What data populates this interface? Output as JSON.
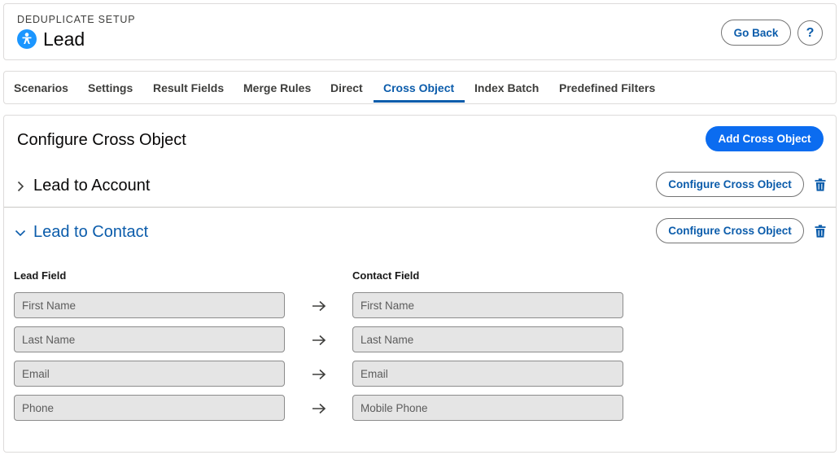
{
  "header": {
    "eyebrow": "DEDUPLICATE SETUP",
    "title": "Lead",
    "go_back_label": "Go Back",
    "help_label": "?"
  },
  "tabs": [
    {
      "label": "Scenarios",
      "active": false
    },
    {
      "label": "Settings",
      "active": false
    },
    {
      "label": "Result Fields",
      "active": false
    },
    {
      "label": "Merge Rules",
      "active": false
    },
    {
      "label": "Direct",
      "active": false
    },
    {
      "label": "Cross Object",
      "active": true
    },
    {
      "label": "Index Batch",
      "active": false
    },
    {
      "label": "Predefined Filters",
      "active": false
    }
  ],
  "main": {
    "title": "Configure Cross Object",
    "add_button_label": "Add Cross Object",
    "sections": [
      {
        "title": "Lead to Account",
        "expanded": false,
        "configure_label": "Configure Cross Object"
      },
      {
        "title": "Lead to Contact",
        "expanded": true,
        "configure_label": "Configure Cross Object"
      }
    ],
    "mapping": {
      "lead_header": "Lead Field",
      "contact_header": "Contact Field",
      "rows": [
        {
          "lead": "First Name",
          "contact": "First Name"
        },
        {
          "lead": "Last Name",
          "contact": "Last Name"
        },
        {
          "lead": "Email",
          "contact": "Email"
        },
        {
          "lead": "Phone",
          "contact": "Mobile Phone"
        }
      ]
    }
  },
  "colors": {
    "brand_blue": "#0b5cab",
    "primary_button": "#0b6cf0",
    "icon_blue": "#1b96ff",
    "field_background": "#e5e5e5"
  },
  "icons": {
    "object": "person-icon",
    "collapsed": "chevron-right-icon",
    "expanded": "chevron-down-icon",
    "delete": "trash-icon",
    "mapping": "arrow-right-icon"
  }
}
